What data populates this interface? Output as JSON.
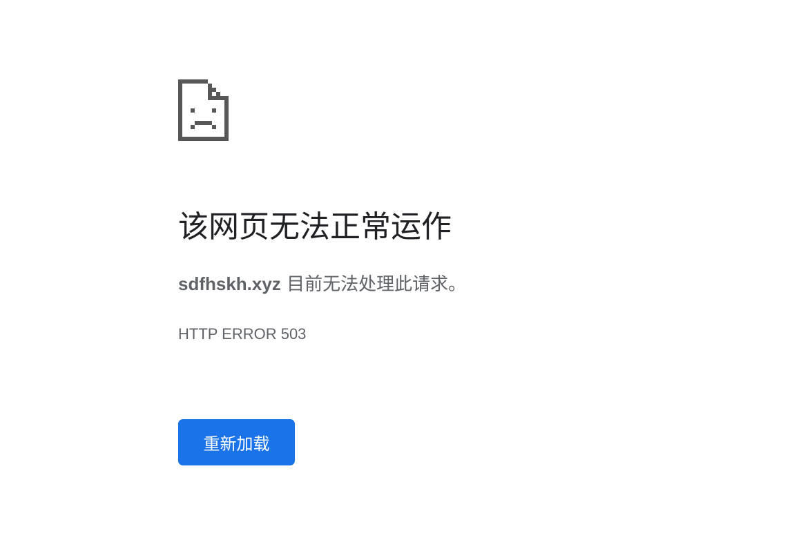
{
  "icon": "sad-page-icon",
  "headline": "该网页无法正常运作",
  "message": {
    "domain": "sdfhskh.xyz",
    "text": " 目前无法处理此请求。"
  },
  "error_code": "HTTP ERROR 503",
  "reload_button": {
    "label": "重新加载"
  },
  "colors": {
    "icon": "#575757",
    "headline": "#202124",
    "body_text": "#5f6368",
    "button_bg": "#1a73e8",
    "button_text": "#ffffff"
  }
}
